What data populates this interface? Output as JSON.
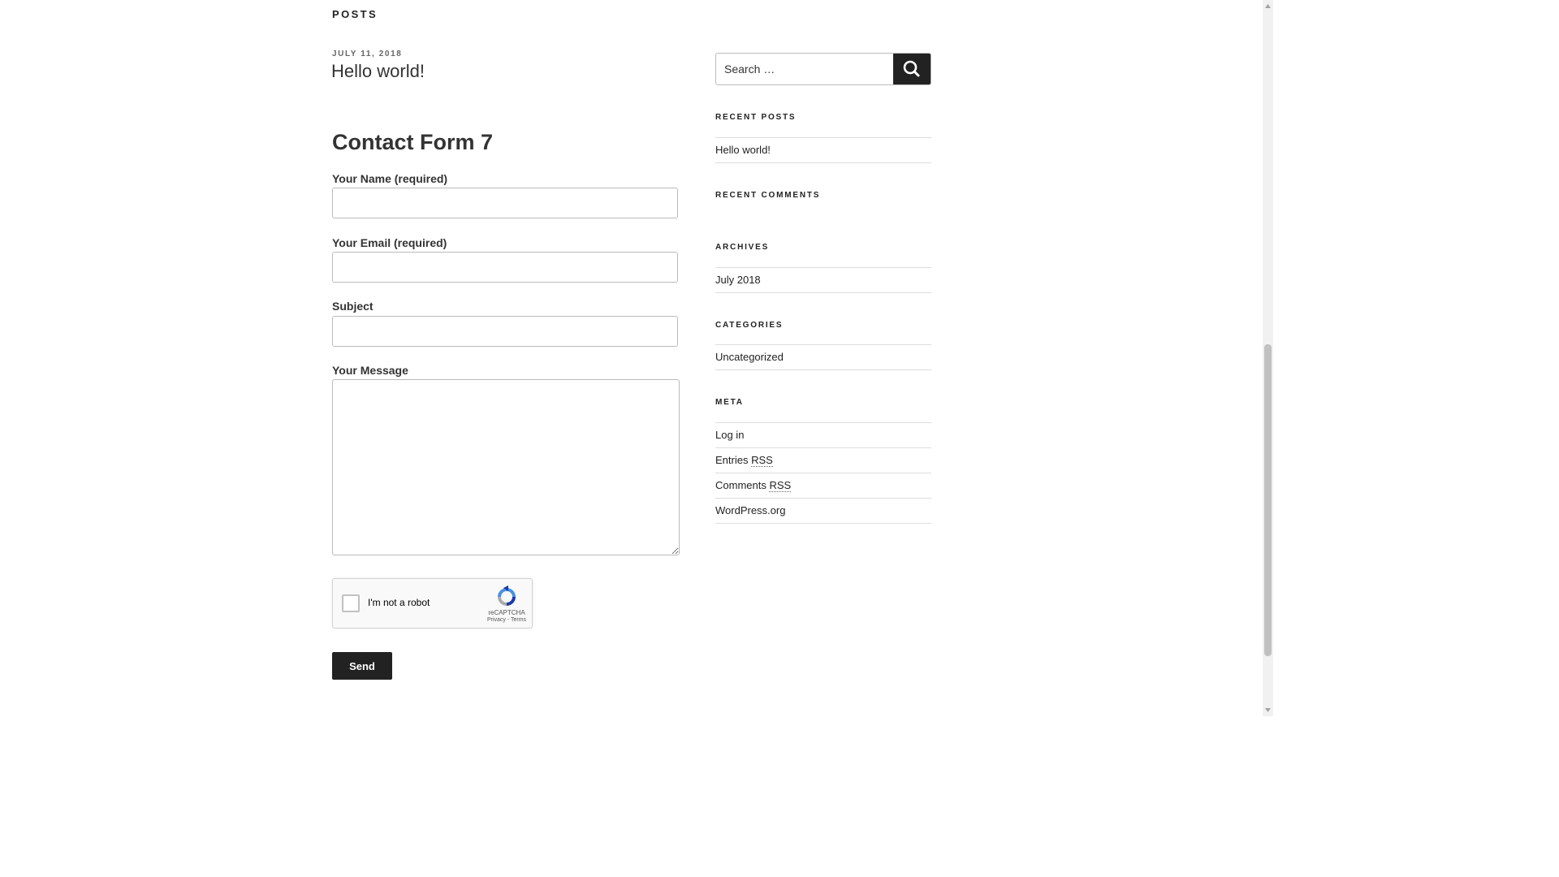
{
  "content": {
    "section_title": "POSTS",
    "post": {
      "date": "JULY 11, 2018",
      "title": "Hello world!"
    },
    "form": {
      "heading": "Contact Form 7",
      "fields": {
        "name_label": "Your Name (required)",
        "name_value": "",
        "email_label": "Your Email (required)",
        "email_value": "",
        "subject_label": "Subject",
        "subject_value": "",
        "message_label": "Your Message",
        "message_value": ""
      },
      "captcha": {
        "checkbox_label": "I'm not a robot",
        "brand": "reCAPTCHA",
        "links": "Privacy - Terms",
        "checked": false
      },
      "send_label": "Send"
    }
  },
  "sidebar": {
    "search": {
      "placeholder": "Search …",
      "icon": "search-icon"
    },
    "recent_posts": {
      "title": "RECENT POSTS",
      "items": [
        "Hello world!"
      ]
    },
    "recent_comments": {
      "title": "RECENT COMMENTS",
      "items": []
    },
    "archives": {
      "title": "ARCHIVES",
      "items": [
        "July 2018"
      ]
    },
    "categories": {
      "title": "CATEGORIES",
      "items": [
        "Uncategorized"
      ]
    },
    "meta": {
      "title": "META",
      "log_in": "Log in",
      "entries_prefix": "Entries ",
      "comments_prefix": "Comments ",
      "rss": "RSS",
      "wordpress": "WordPress.org"
    }
  },
  "colors": {
    "text": "#222222",
    "button_bg": "#222222",
    "border": "#bbbbbb",
    "divider": "#dddddd"
  }
}
